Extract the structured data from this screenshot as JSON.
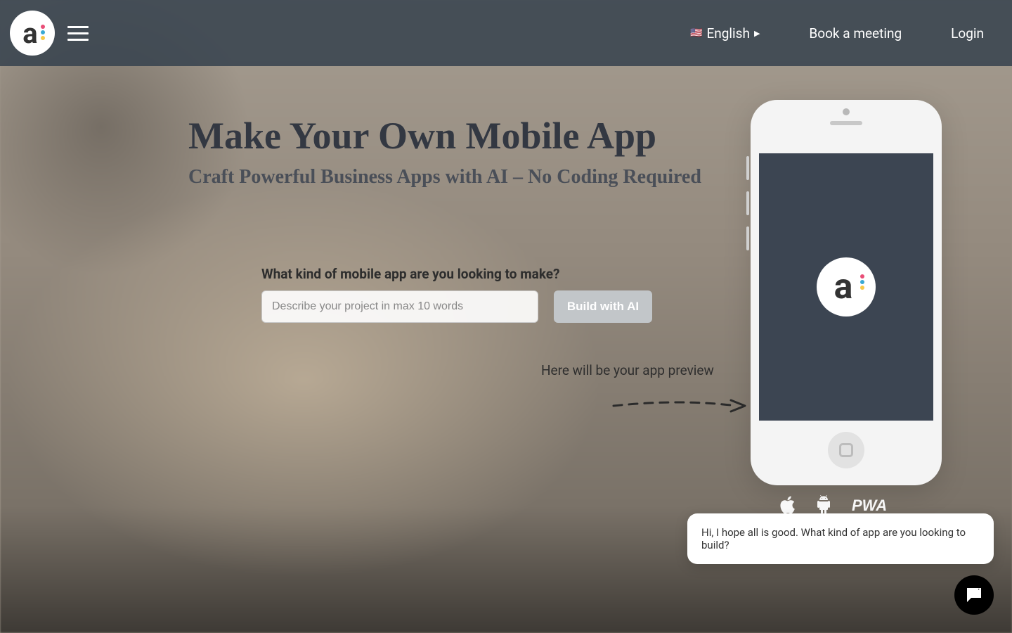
{
  "header": {
    "language_label": "English",
    "flag": "🇺🇸",
    "book_meeting": "Book a meeting",
    "login": "Login"
  },
  "hero": {
    "headline": "Make Your Own Mobile App",
    "subheadline": "Craft Powerful Business Apps with AI – No Coding Required"
  },
  "form": {
    "label": "What kind of mobile app are you looking to make?",
    "placeholder": "Describe your project in max 10 words",
    "button": "Build with AI"
  },
  "preview_hint": "Here will be your app preview",
  "chat": {
    "message": "Hi, I hope all is good. What kind of app are you looking to build?"
  },
  "icons": {
    "logo": "appery-logo",
    "hamburger": "menu-icon",
    "apple": "apple-icon",
    "android": "android-icon",
    "pwa": "pwa-icon",
    "chat": "chat-icon"
  },
  "colors": {
    "header_bg": "#384350",
    "screen_bg": "#3c4552",
    "button_disabled": "#c2c6c9"
  }
}
